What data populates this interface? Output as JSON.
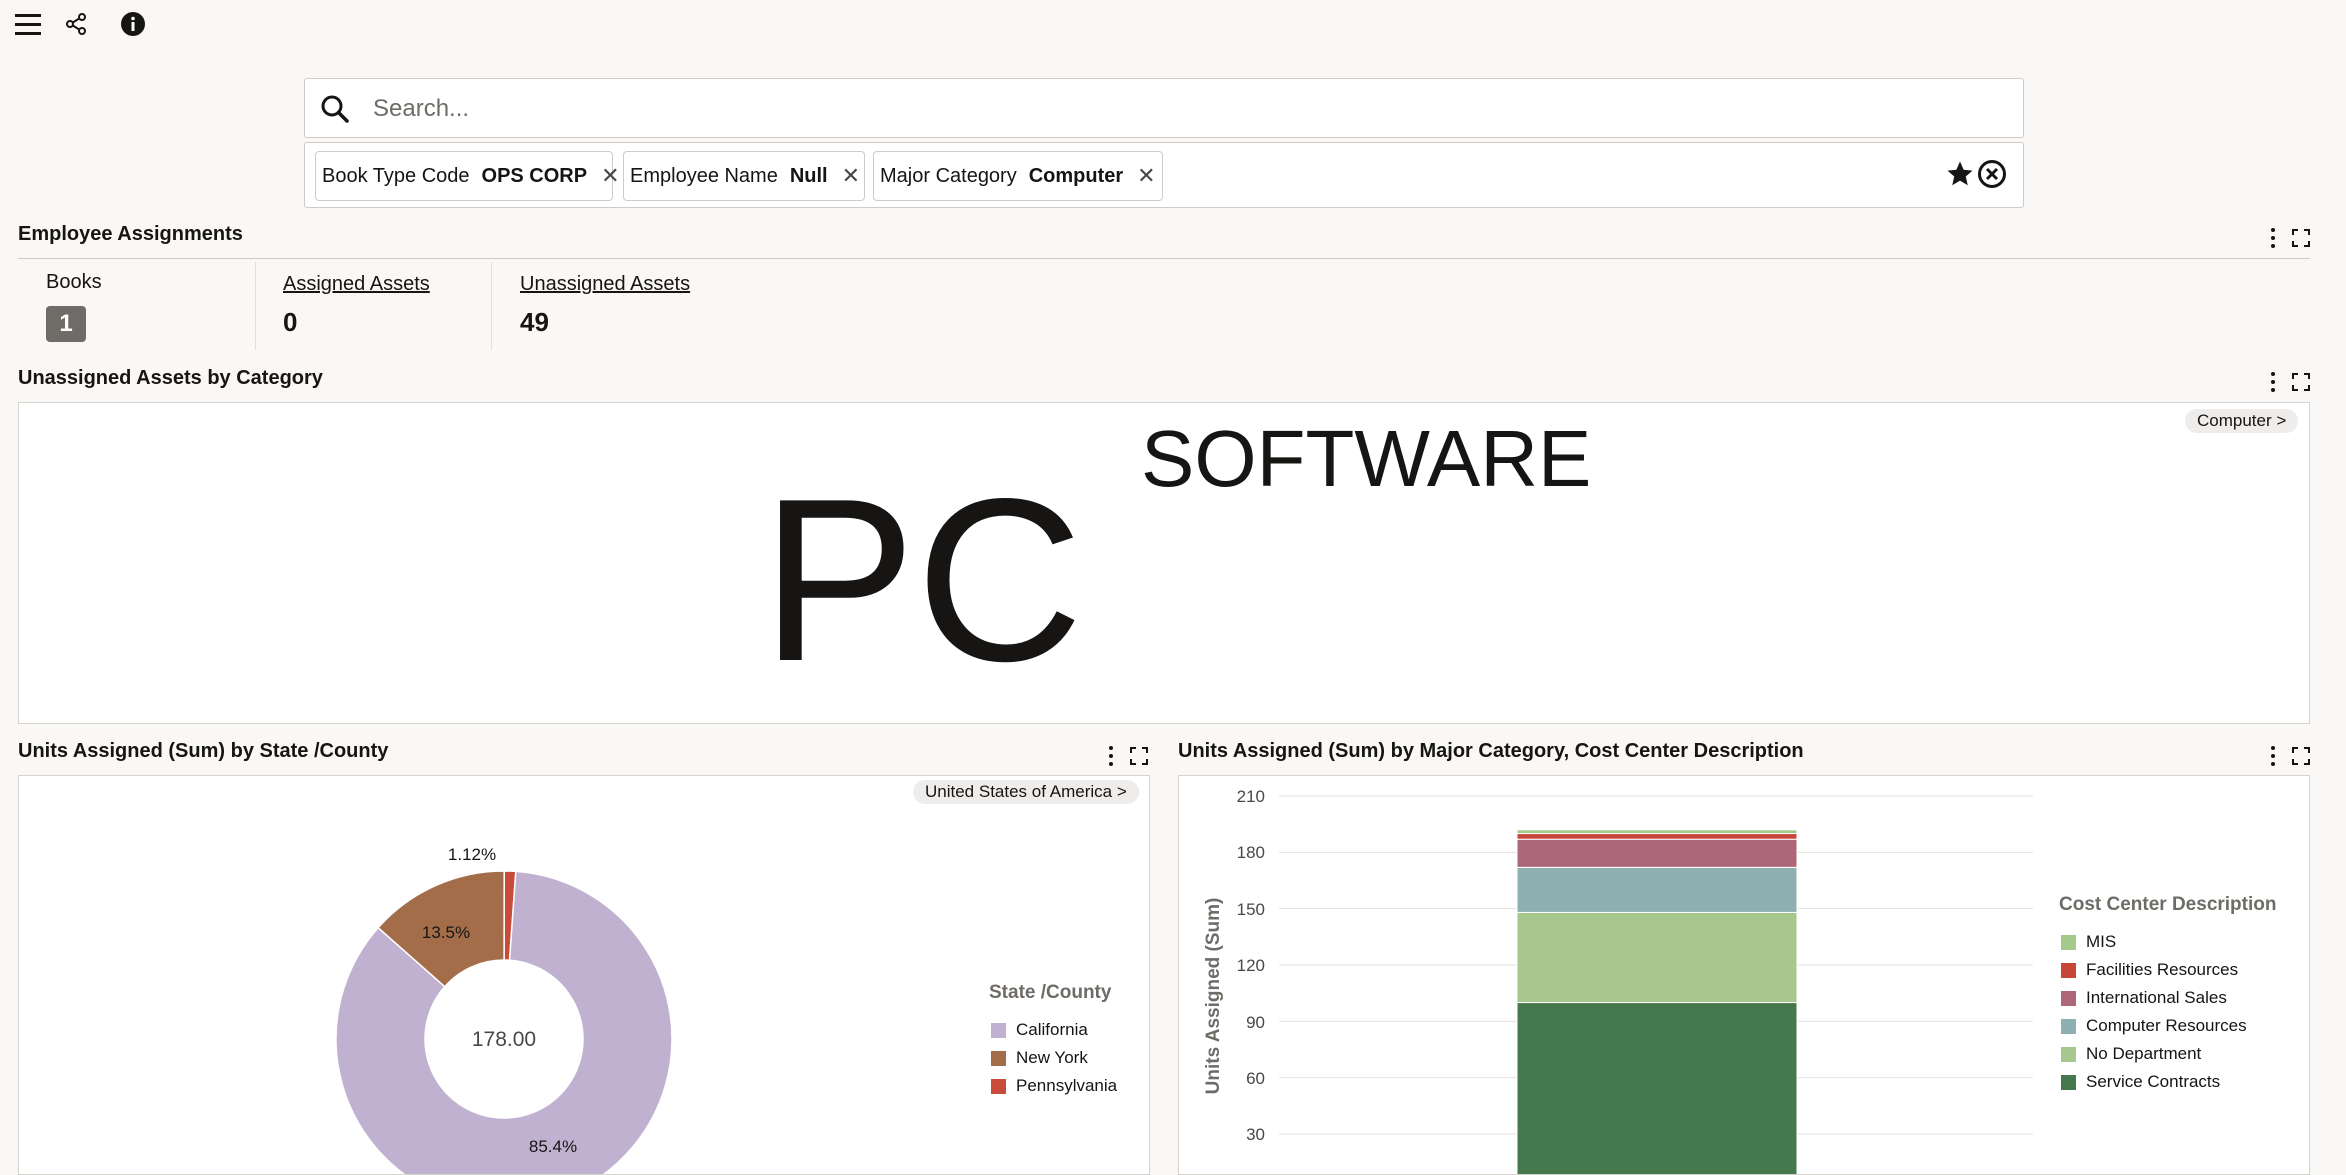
{
  "toolbar": {
    "menu_icon": "hamburger-menu-icon",
    "share_icon": "share-icon",
    "info_icon": "info-icon"
  },
  "search": {
    "placeholder": "Search..."
  },
  "filters": [
    {
      "name": "Book Type Code",
      "value": "OPS CORP"
    },
    {
      "name": "Employee Name",
      "value": "Null"
    },
    {
      "name": "Major Category",
      "value": "Computer"
    }
  ],
  "employee_assignments": {
    "title": "Employee Assignments",
    "books_label": "Books",
    "books_value": "1",
    "assigned_label": "Assigned Assets",
    "assigned_value": "0",
    "unassigned_label": "Unassigned Assets",
    "unassigned_value": "49"
  },
  "unassigned_by_category": {
    "title": "Unassigned Assets by Category",
    "drill_label": "Computer >",
    "words": [
      "PC",
      "SOFTWARE"
    ]
  },
  "state_chart": {
    "title": "Units Assigned (Sum) by State /County",
    "drill_label": "United States of America >",
    "center_label": "178.00",
    "legend_title": "State /County",
    "slice_labels": [
      "85.4%",
      "13.5%",
      "1.12%"
    ]
  },
  "category_chart": {
    "title": "Units Assigned (Sum) by Major Category, Cost Center Description",
    "ylabel": "Units Assigned (Sum)",
    "legend_title": "Cost Center Description",
    "y_ticks": [
      "210",
      "180",
      "150",
      "120",
      "90",
      "60",
      "30"
    ]
  },
  "colors": {
    "california": "#c1b1d1",
    "new_york": "#a26d48",
    "pennsylvania": "#c94b39",
    "mis": "#a4c98a",
    "facilities_resources": "#c8453a",
    "international_sales": "#ad6778",
    "computer_resources": "#8fb0b2",
    "no_department": "#a8c78e",
    "service_contracts": "#46784d"
  },
  "chart_data": [
    {
      "type": "pie",
      "title": "Units Assigned (Sum) by State /County",
      "legend_title": "State /County",
      "total": 178.0,
      "slices": [
        {
          "name": "California",
          "percent": 85.4,
          "color": "#c1b1d1"
        },
        {
          "name": "New York",
          "percent": 13.5,
          "color": "#a26d48"
        },
        {
          "name": "Pennsylvania",
          "percent": 1.12,
          "color": "#c94b39"
        }
      ]
    },
    {
      "type": "bar",
      "stacked": true,
      "title": "Units Assigned (Sum) by Major Category, Cost Center Description",
      "ylabel": "Units Assigned (Sum)",
      "ylim": [
        0,
        210
      ],
      "yticks": [
        30,
        60,
        90,
        120,
        150,
        180,
        210
      ],
      "grid": true,
      "legend_title": "Cost Center Description",
      "legend_position": "right",
      "series": [
        {
          "name": "Service Contracts",
          "value": 100,
          "color": "#46784d"
        },
        {
          "name": "No Department",
          "value": 48,
          "color": "#a8c78e"
        },
        {
          "name": "Computer Resources",
          "value": 24,
          "color": "#8fb0b2"
        },
        {
          "name": "International Sales",
          "value": 15,
          "color": "#ad6778"
        },
        {
          "name": "Facilities Resources",
          "value": 3,
          "color": "#c8453a"
        },
        {
          "name": "MIS",
          "value": 2,
          "color": "#a4c98a"
        }
      ],
      "legend_order": [
        "MIS",
        "Facilities Resources",
        "International Sales",
        "Computer Resources",
        "No Department",
        "Service Contracts"
      ]
    }
  ]
}
